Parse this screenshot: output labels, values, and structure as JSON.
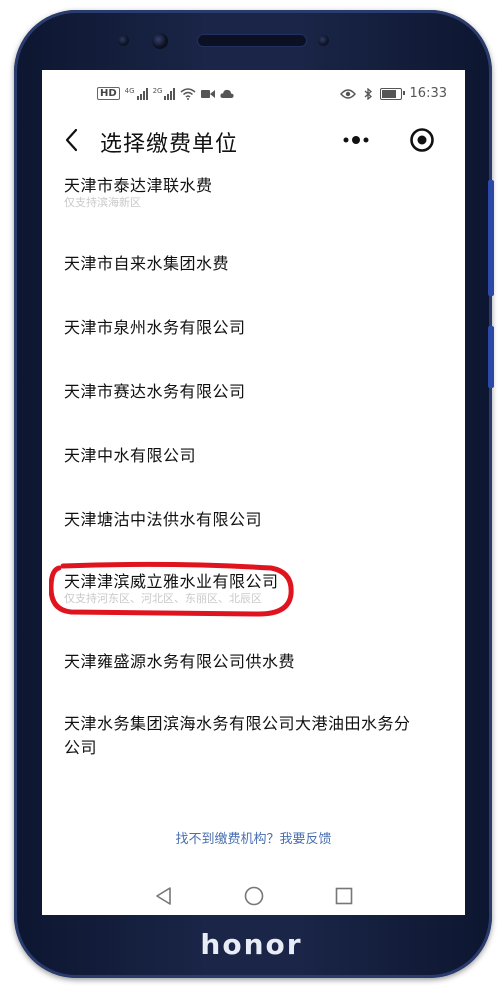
{
  "device": {
    "brand": "honor"
  },
  "status_bar": {
    "hd_label": "HD",
    "sim1_tag": "4G",
    "sim2_tag": "2G",
    "time": "16:33"
  },
  "header": {
    "title": "选择缴费单位"
  },
  "companies": [
    {
      "name": "天津市泰达津联水费",
      "subtitle": "仅支持滨海新区"
    },
    {
      "name": "天津市自来水集团水费",
      "subtitle": ""
    },
    {
      "name": "天津市泉州水务有限公司",
      "subtitle": ""
    },
    {
      "name": "天津市赛达水务有限公司",
      "subtitle": ""
    },
    {
      "name": "天津中水有限公司",
      "subtitle": ""
    },
    {
      "name": "天津塘沽中法供水有限公司",
      "subtitle": ""
    },
    {
      "name": "天津津滨威立雅水业有限公司",
      "subtitle": "仅支持河东区、河北区、东丽区、北辰区",
      "highlighted": true
    },
    {
      "name": "天津雍盛源水务有限公司供水费",
      "subtitle": ""
    },
    {
      "name": "天津水务集团滨海水务有限公司大港油田水务分公司",
      "subtitle": ""
    }
  ],
  "footer": {
    "feedback_link": "找不到缴费机构？我要反馈"
  },
  "colors": {
    "phone_body": "#1a2547",
    "annotation": "#e0141e",
    "link": "#4a6fb0"
  }
}
